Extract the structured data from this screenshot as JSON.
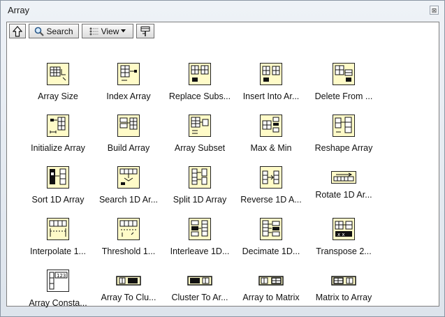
{
  "window": {
    "title": "Array",
    "close_glyph": "⊠"
  },
  "toolbar": {
    "up_icon": "up-arrow-icon",
    "search_label": "Search",
    "view_label": "View",
    "pin_icon": "pin-icon"
  },
  "items": [
    {
      "label": "Array Size",
      "icon": "array-size-icon"
    },
    {
      "label": "Index Array",
      "icon": "index-array-icon"
    },
    {
      "label": "Replace Subs...",
      "icon": "replace-subset-icon"
    },
    {
      "label": "Insert Into Ar...",
      "icon": "insert-into-array-icon"
    },
    {
      "label": "Delete From ...",
      "icon": "delete-from-array-icon"
    },
    {
      "label": "Initialize Array",
      "icon": "initialize-array-icon"
    },
    {
      "label": "Build Array",
      "icon": "build-array-icon"
    },
    {
      "label": "Array Subset",
      "icon": "array-subset-icon"
    },
    {
      "label": "Max & Min",
      "icon": "max-min-icon"
    },
    {
      "label": "Reshape Array",
      "icon": "reshape-array-icon"
    },
    {
      "label": "Sort 1D Array",
      "icon": "sort-1d-array-icon"
    },
    {
      "label": "Search 1D Ar...",
      "icon": "search-1d-array-icon"
    },
    {
      "label": "Split 1D Array",
      "icon": "split-1d-array-icon"
    },
    {
      "label": "Reverse 1D A...",
      "icon": "reverse-1d-array-icon"
    },
    {
      "label": "Rotate 1D Ar...",
      "icon": "rotate-1d-array-icon"
    },
    {
      "label": "Interpolate 1...",
      "icon": "interpolate-1d-array-icon"
    },
    {
      "label": "Threshold 1...",
      "icon": "threshold-1d-array-icon"
    },
    {
      "label": "Interleave 1D...",
      "icon": "interleave-1d-arrays-icon"
    },
    {
      "label": "Decimate 1D...",
      "icon": "decimate-1d-array-icon"
    },
    {
      "label": "Transpose 2...",
      "icon": "transpose-2d-array-icon"
    },
    {
      "label": "Array Consta...",
      "icon": "array-constant-icon"
    },
    {
      "label": "Array To Clu...",
      "icon": "array-to-cluster-icon"
    },
    {
      "label": "Cluster To Ar...",
      "icon": "cluster-to-array-icon"
    },
    {
      "label": "Array to Matrix",
      "icon": "array-to-matrix-icon"
    },
    {
      "label": "Matrix to Array",
      "icon": "matrix-to-array-icon"
    }
  ]
}
